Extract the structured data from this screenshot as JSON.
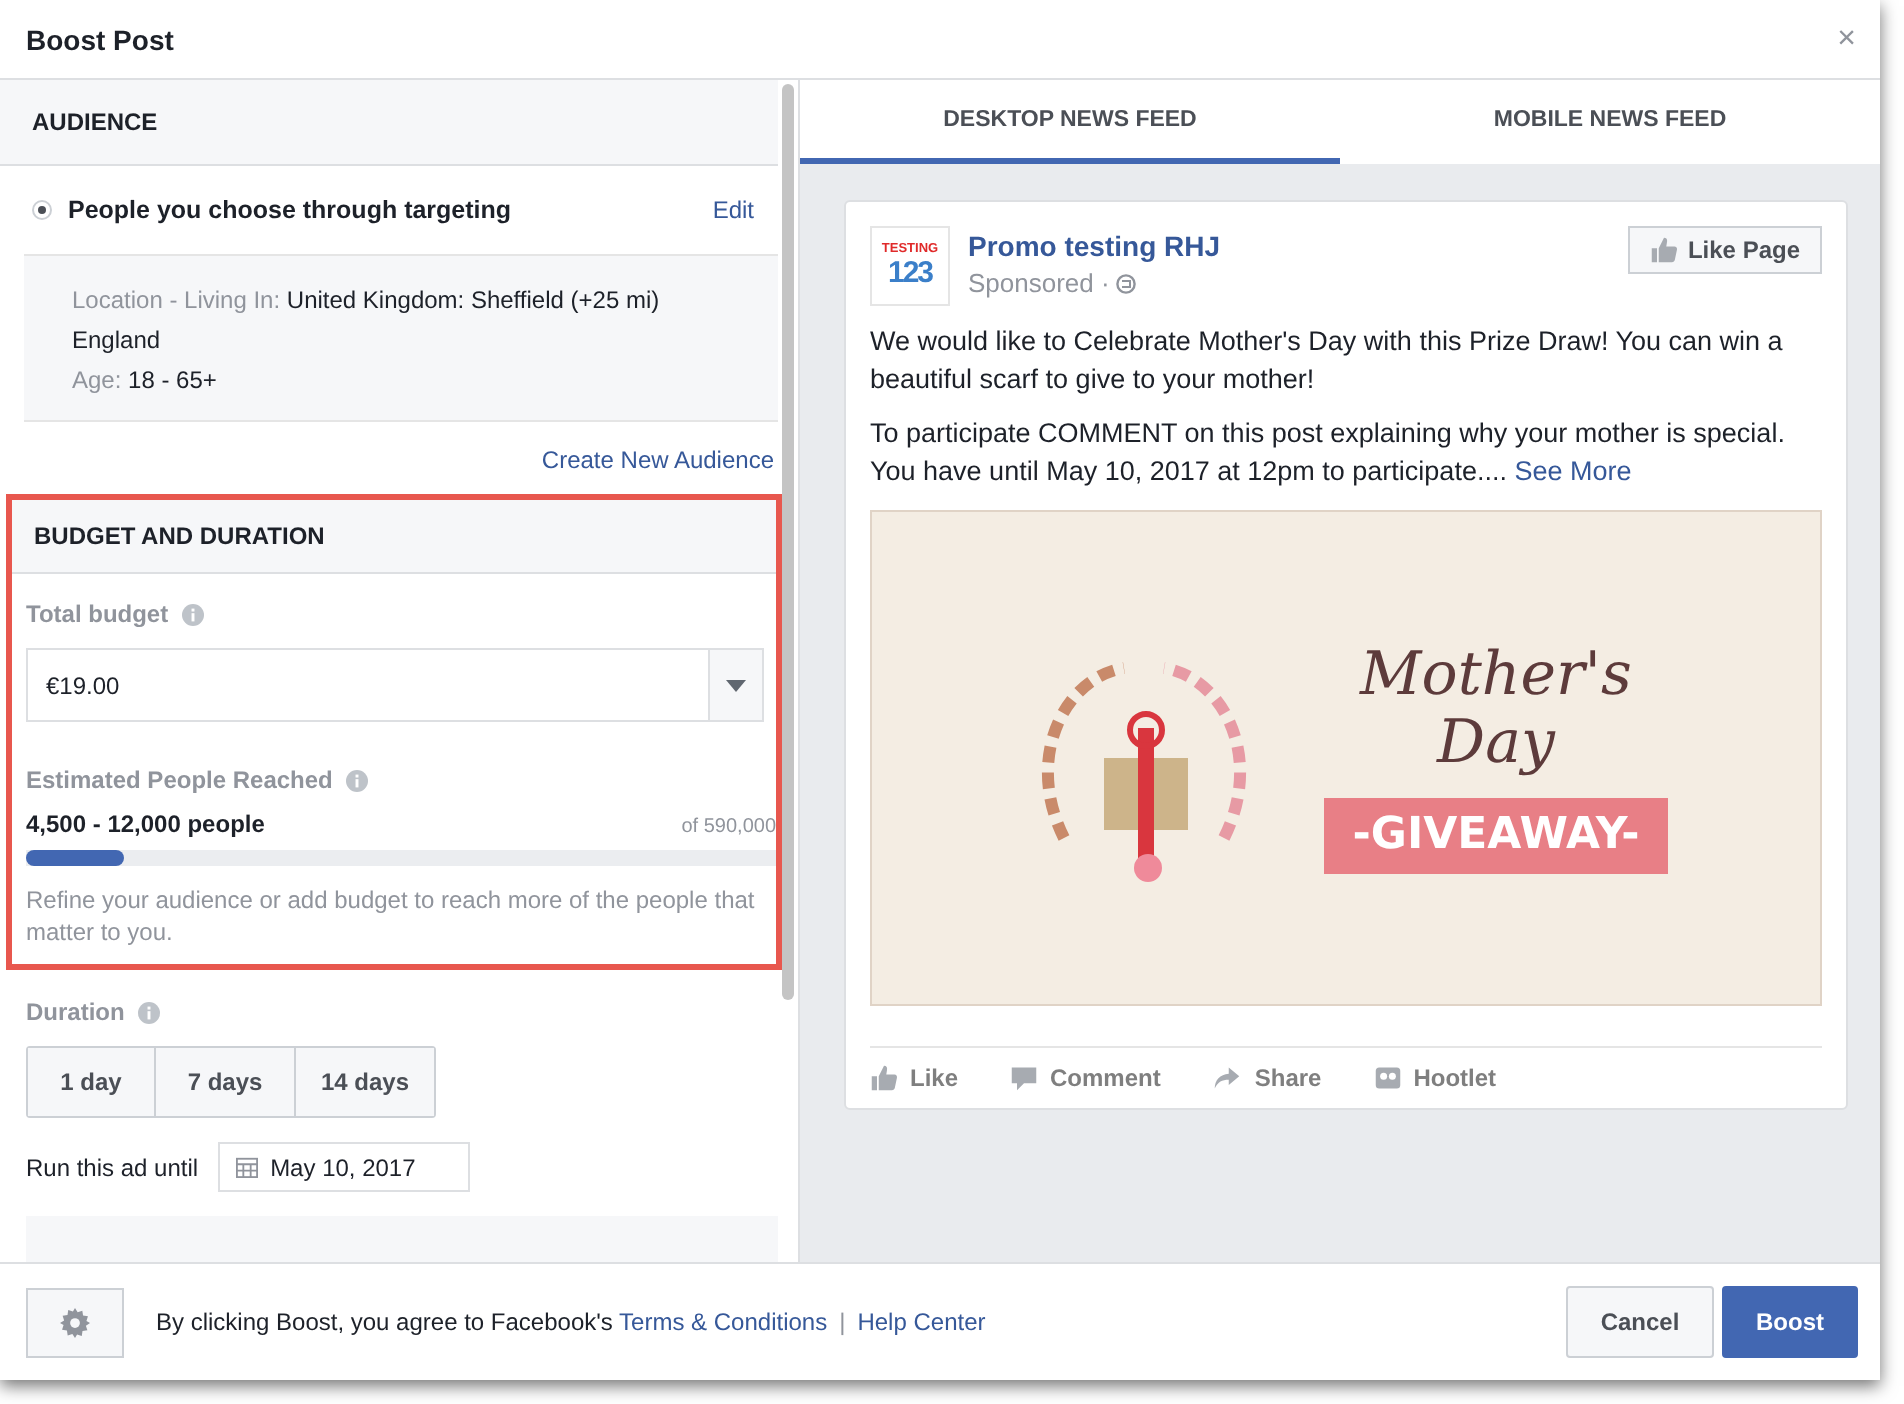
{
  "window": {
    "title": "Boost Post",
    "close": "×"
  },
  "audience": {
    "heading": "AUDIENCE",
    "option": {
      "label": "People you choose through targeting",
      "selected": true
    },
    "edit": "Edit",
    "details": [
      {
        "label": "Location - Living In:",
        "value": "United Kingdom: Sheffield (+25 mi) England"
      },
      {
        "label": "Age:",
        "value": "18 - 65+"
      }
    ],
    "create_link": "Create New Audience"
  },
  "budget": {
    "heading": "BUDGET AND DURATION",
    "highlighted": true,
    "total_label": "Total budget",
    "total_value": "€19.00",
    "reach_label": "Estimated People Reached",
    "reach_value": "4,500 - 12,000 people",
    "reach_of": "of 590,000",
    "level": 0.13,
    "hint": "Refine your audience or add budget to reach more of the people that matter to you."
  },
  "duration": {
    "label": "Duration",
    "options": [
      {
        "label": "1 day",
        "selected": false
      },
      {
        "label": "7 days",
        "selected": false
      },
      {
        "label": "14 days",
        "selected": false
      }
    ],
    "until_label": "Run this ad until",
    "until_value": "May 10, 2017"
  },
  "tabs": [
    {
      "label": "DESKTOP NEWS FEED",
      "selected": true
    },
    {
      "label": "MOBILE NEWS FEED",
      "selected": false
    }
  ],
  "post": {
    "logo_top": "TESTING",
    "logo_digits": "123",
    "page_name": "Promo testing RHJ",
    "sponsored": "Sponsored ·",
    "like_page": "Like Page",
    "paragraphs": [
      "We would like to Celebrate Mother's Day with this Prize Draw! You can win a beautiful scarf to give to your mother!",
      "To participate COMMENT on this post explaining why your mother is special.\nYou have until May 10, 2017 at 12pm to participate...."
    ],
    "see_more": "See More",
    "image_texts": [
      "Mother's",
      "Day",
      "-GIVEAWAY-"
    ],
    "actions": [
      {
        "kind": "like",
        "label": "Like"
      },
      {
        "kind": "comment",
        "label": "Comment"
      },
      {
        "kind": "share",
        "label": "Share"
      },
      {
        "kind": "hootlet",
        "label": "Hootlet"
      }
    ]
  },
  "footer": {
    "agree": "By clicking Boost, you agree to Facebook's",
    "terms": "Terms & Conditions",
    "separator": "|",
    "help": "Help Center",
    "cancel": "Cancel",
    "boost": "Boost"
  }
}
